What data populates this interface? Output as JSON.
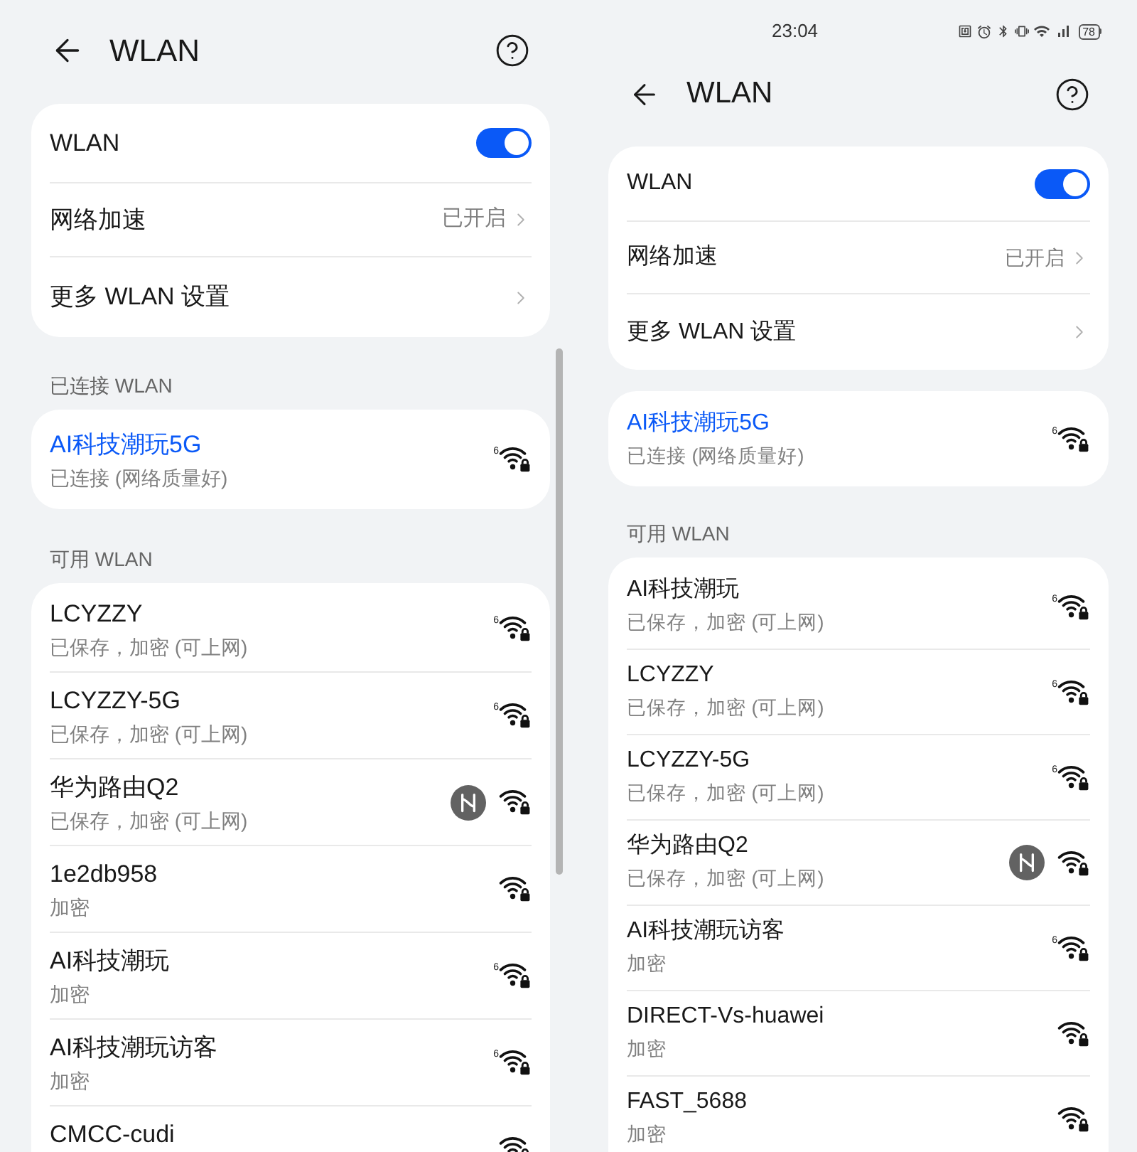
{
  "screens": [
    {
      "header": {
        "title": "WLAN"
      },
      "settings": [
        {
          "kind": "toggle",
          "label": "WLAN",
          "on": true
        },
        {
          "kind": "link",
          "label": "网络加速",
          "value": "已开启"
        },
        {
          "kind": "link",
          "label": "更多 WLAN 设置"
        }
      ],
      "connected": {
        "heading": "已连接 WLAN",
        "network": {
          "name": "AI科技潮玩5G",
          "status": "已连接 (网络质量好)",
          "wifi_standard": "6"
        }
      },
      "available": {
        "heading": "可用 WLAN",
        "networks": [
          {
            "name": "LCYZZY",
            "status": "已保存，加密 (可上网)",
            "wifi_standard": "6"
          },
          {
            "name": "LCYZZY-5G",
            "status": "已保存，加密 (可上网)",
            "wifi_standard": "6"
          },
          {
            "name": "华为路由Q2",
            "status": "已保存，加密 (可上网)",
            "router_logo": true
          },
          {
            "name": "1e2db958",
            "status": "加密"
          },
          {
            "name": "AI科技潮玩",
            "status": "加密",
            "wifi_standard": "6"
          },
          {
            "name": "AI科技潮玩访客",
            "status": "加密",
            "wifi_standard": "6"
          },
          {
            "name": "CMCC-cudi"
          }
        ]
      },
      "scrollbar": true
    },
    {
      "status_bar": {
        "time": "23:04",
        "battery": "78"
      },
      "header": {
        "title": "WLAN"
      },
      "settings": [
        {
          "kind": "toggle",
          "label": "WLAN",
          "on": true
        },
        {
          "kind": "link",
          "label": "网络加速",
          "value": "已开启"
        },
        {
          "kind": "link",
          "label": "更多 WLAN 设置"
        }
      ],
      "connected": {
        "network": {
          "name": "AI科技潮玩5G",
          "status": "已连接 (网络质量好)",
          "wifi_standard": "6"
        }
      },
      "available": {
        "heading": "可用 WLAN",
        "networks": [
          {
            "name": "AI科技潮玩",
            "status": "已保存，加密 (可上网)",
            "wifi_standard": "6"
          },
          {
            "name": "LCYZZY",
            "status": "已保存，加密 (可上网)",
            "wifi_standard": "6"
          },
          {
            "name": "LCYZZY-5G",
            "status": "已保存，加密 (可上网)",
            "wifi_standard": "6"
          },
          {
            "name": "华为路由Q2",
            "status": "已保存，加密 (可上网)",
            "router_logo": true
          },
          {
            "name": "AI科技潮玩访客",
            "status": "加密",
            "wifi_standard": "6"
          },
          {
            "name": "DIRECT-Vs-huawei",
            "status": "加密"
          },
          {
            "name": "FAST_5688",
            "status": "加密"
          }
        ]
      }
    }
  ]
}
